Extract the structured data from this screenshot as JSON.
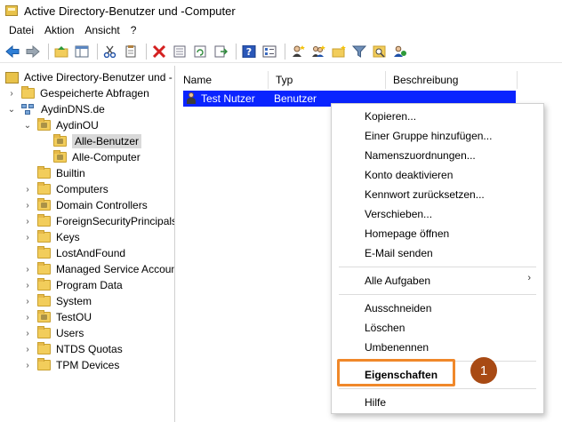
{
  "window": {
    "title": "Active Directory-Benutzer und -Computer"
  },
  "menubar": {
    "items": [
      "Datei",
      "Aktion",
      "Ansicht",
      "?"
    ]
  },
  "toolbar": {
    "icons": [
      "back-arrow-icon",
      "forward-arrow-icon",
      "up-folder-icon",
      "show-hide-tree-icon",
      "cut-icon",
      "copy-icon",
      "delete-icon",
      "properties-icon",
      "refresh-icon",
      "export-list-icon",
      "help-icon",
      "details-icon",
      "create-user-icon",
      "create-group-icon",
      "create-ou-icon",
      "filter-icon",
      "find-icon",
      "add-to-group-icon"
    ]
  },
  "tree": {
    "root": "Active Directory-Benutzer und -",
    "saved_queries": "Gespeicherte Abfragen",
    "domain": "AydinDNS.de",
    "ou": "AydinOU",
    "ou_children": [
      "Alle-Benutzer",
      "Alle-Computer"
    ],
    "containers": [
      "Builtin",
      "Computers",
      "Domain Controllers",
      "ForeignSecurityPrincipals",
      "Keys",
      "LostAndFound",
      "Managed Service Accounts",
      "Program Data",
      "System",
      "TestOU",
      "Users",
      "NTDS Quotas",
      "TPM Devices"
    ]
  },
  "list": {
    "columns": [
      "Name",
      "Typ",
      "Beschreibung"
    ],
    "rows": [
      {
        "name": "Test Nutzer",
        "type": "Benutzer",
        "description": ""
      }
    ]
  },
  "context_menu": {
    "items": [
      "Kopieren...",
      "Einer Gruppe hinzufügen...",
      "Namenszuordnungen...",
      "Konto deaktivieren",
      "Kennwort zurücksetzen...",
      "Verschieben...",
      "Homepage öffnen",
      "E-Mail senden"
    ],
    "all_tasks": "Alle Aufgaben",
    "edit_items": [
      "Ausschneiden",
      "Löschen",
      "Umbenennen"
    ],
    "properties": "Eigenschaften",
    "help": "Hilfe",
    "submenu_arrow": "›"
  },
  "annotation": {
    "badge": "1",
    "color": "#f0882a"
  },
  "colors": {
    "selection": "#0a24ff",
    "folder": "#f2cd5b"
  }
}
